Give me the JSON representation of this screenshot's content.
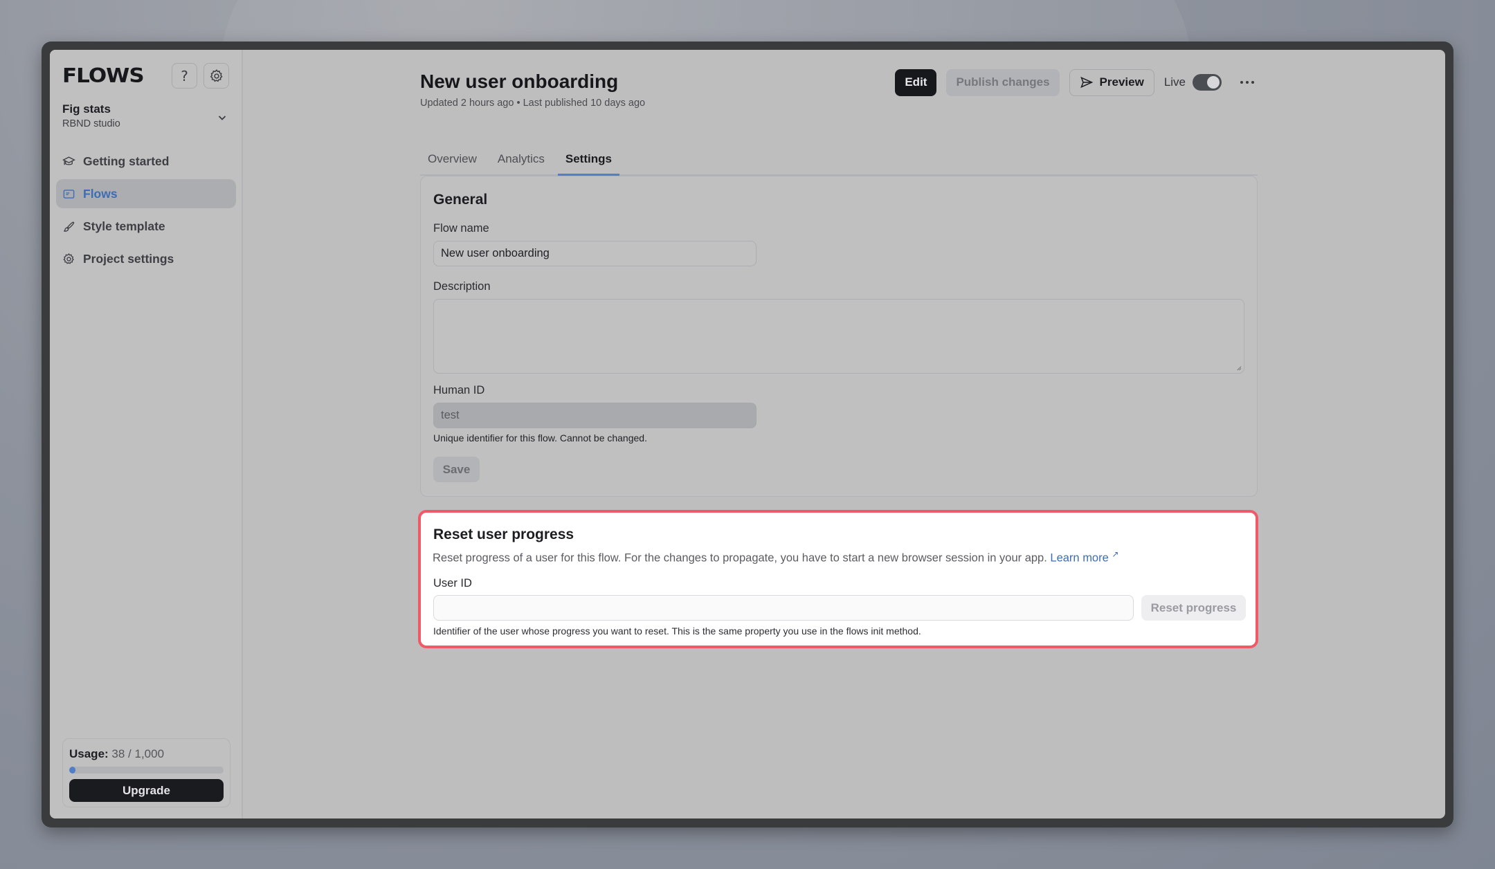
{
  "app": {
    "logo_text": "FLOWS"
  },
  "sidebar": {
    "project_name": "Fig stats",
    "organization": "RBND studio",
    "items": [
      {
        "label": "Getting started",
        "icon": "graduation-cap-icon",
        "active": false
      },
      {
        "label": "Flows",
        "icon": "flows-icon",
        "active": true
      },
      {
        "label": "Style template",
        "icon": "brush-icon",
        "active": false
      },
      {
        "label": "Project settings",
        "icon": "gear-icon",
        "active": false
      }
    ],
    "usage": {
      "label": "Usage:",
      "value": "38 / 1,000",
      "used": 38,
      "limit": 1000,
      "upgrade_label": "Upgrade"
    }
  },
  "header": {
    "title": "New user onboarding",
    "subtitle": "Updated 2 hours ago • Last published 10 days ago",
    "edit_label": "Edit",
    "publish_label": "Publish changes",
    "preview_label": "Preview",
    "live_label": "Live",
    "live_enabled": true
  },
  "tabs": [
    {
      "label": "Overview",
      "active": false
    },
    {
      "label": "Analytics",
      "active": false
    },
    {
      "label": "Settings",
      "active": true
    }
  ],
  "general": {
    "heading": "General",
    "flow_name_label": "Flow name",
    "flow_name_value": "New user onboarding",
    "description_label": "Description",
    "description_value": "",
    "human_id_label": "Human ID",
    "human_id_value": "test",
    "human_id_hint": "Unique identifier for this flow. Cannot be changed.",
    "save_label": "Save"
  },
  "reset": {
    "heading": "Reset user progress",
    "description": "Reset progress of a user for this flow. For the changes to propagate, you have to start a new browser session in your app.",
    "learn_more": "Learn more",
    "learn_more_icon": "↗",
    "user_id_label": "User ID",
    "user_id_value": "",
    "button_label": "Reset progress",
    "hint": "Identifier of the user whose progress you want to reset. This is the same property you use in the flows init method."
  },
  "colors": {
    "accent": "#4f7fc6",
    "highlight_border": "#f05a68",
    "primary_button": "#17181b"
  }
}
